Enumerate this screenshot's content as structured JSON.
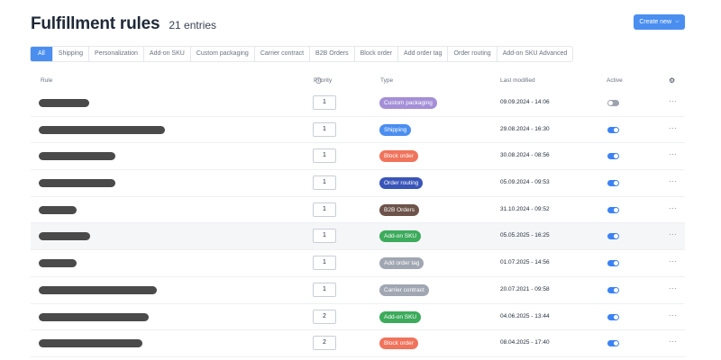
{
  "header": {
    "title": "Fulfillment rules",
    "entries": "21 entries",
    "create_label": "Create new"
  },
  "tabs": [
    "All",
    "Shipping",
    "Personalization",
    "Add-on SKU",
    "Custom packaging",
    "Carrier contract",
    "B2B Orders",
    "Block order",
    "Add order tag",
    "Order routing",
    "Add-on SKU Advanced"
  ],
  "columns": {
    "rule": "Rule",
    "priority": "Priority",
    "type": "Type",
    "modified": "Last modified",
    "active": "Active",
    "settings_icon": "gear-icon"
  },
  "rows": [
    {
      "priority": "1",
      "type": "Custom packaging",
      "color": "#a48fd6",
      "date": "09.09.2024 - 14:06",
      "active": false
    },
    {
      "priority": "1",
      "type": "Shipping",
      "color": "#4a8ef0",
      "date": "29.08.2024 - 16:30",
      "active": true
    },
    {
      "priority": "1",
      "type": "Block order",
      "color": "#f0735c",
      "date": "30.08.2024 - 08:56",
      "active": true
    },
    {
      "priority": "1",
      "type": "Order routing",
      "color": "#3955b8",
      "date": "05.09.2024 - 09:53",
      "active": true
    },
    {
      "priority": "1",
      "type": "B2B Orders",
      "color": "#6d5349",
      "date": "31.10.2024 - 09:52",
      "active": true
    },
    {
      "priority": "1",
      "type": "Add-on SKU",
      "color": "#3cab5c",
      "date": "05.05.2025 - 16:25",
      "active": true
    },
    {
      "priority": "1",
      "type": "Add order tag",
      "color": "#a0a6b2",
      "date": "01.07.2025 - 14:56",
      "active": true
    },
    {
      "priority": "1",
      "type": "Carrier contract",
      "color": "#a0a6b2",
      "date": "20.07.2021 - 09:58",
      "active": true
    },
    {
      "priority": "2",
      "type": "Add-on SKU",
      "color": "#3cab5c",
      "date": "04.06.2025 - 13:44",
      "active": true
    },
    {
      "priority": "2",
      "type": "Block order",
      "color": "#f0735c",
      "date": "08.04.2025 - 17:40",
      "active": true
    }
  ]
}
